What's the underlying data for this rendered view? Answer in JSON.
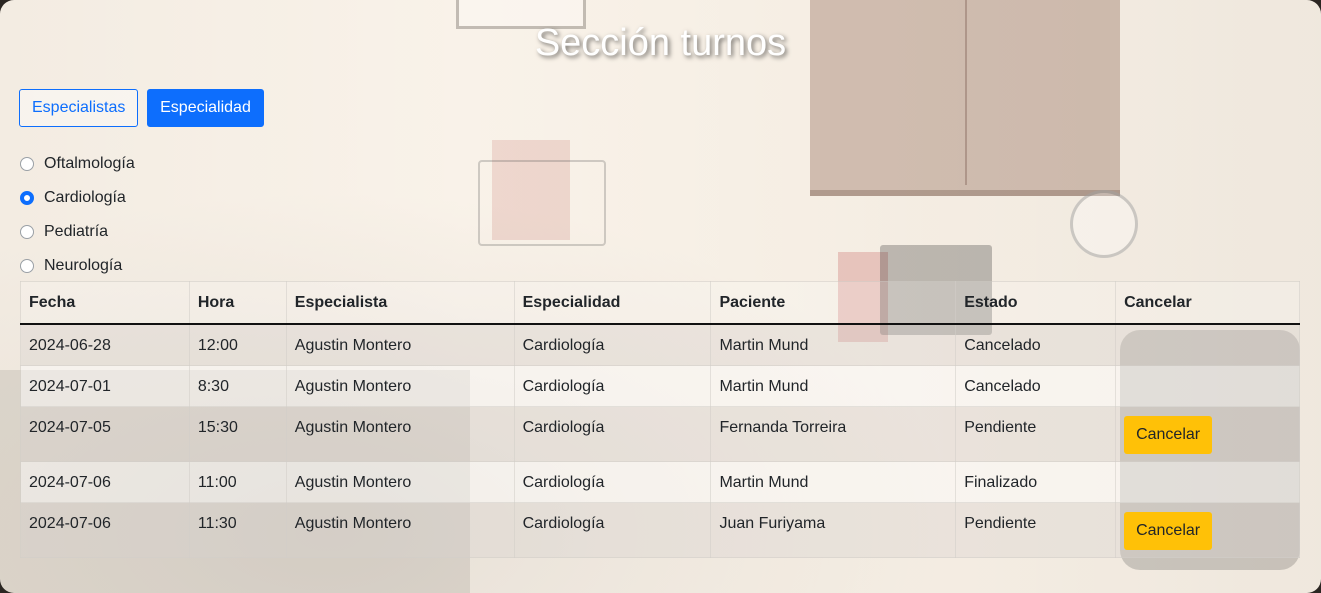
{
  "page": {
    "title": "Sección turnos"
  },
  "filter_buttons": {
    "especialistas_label": "Especialistas",
    "especialidad_label": "Especialidad"
  },
  "specialties": [
    {
      "label": "Oftalmología",
      "checked": false
    },
    {
      "label": "Cardiología",
      "checked": true
    },
    {
      "label": "Pediatría",
      "checked": false
    },
    {
      "label": "Neurología",
      "checked": false
    }
  ],
  "table": {
    "headers": [
      "Fecha",
      "Hora",
      "Especialista",
      "Especialidad",
      "Paciente",
      "Estado",
      "Cancelar"
    ],
    "rows": [
      {
        "fecha": "2024-06-28",
        "hora": "12:00",
        "especialista": "Agustin Montero",
        "especialidad": "Cardiología",
        "paciente": "Martin Mund",
        "estado": "Cancelado",
        "cancelar": ""
      },
      {
        "fecha": "2024-07-01",
        "hora": "8:30",
        "especialista": "Agustin Montero",
        "especialidad": "Cardiología",
        "paciente": "Martin Mund",
        "estado": "Cancelado",
        "cancelar": ""
      },
      {
        "fecha": "2024-07-05",
        "hora": "15:30",
        "especialista": "Agustin Montero",
        "especialidad": "Cardiología",
        "paciente": "Fernanda Torreira",
        "estado": "Pendiente",
        "cancelar": "Cancelar"
      },
      {
        "fecha": "2024-07-06",
        "hora": "11:00",
        "especialista": "Agustin Montero",
        "especialidad": "Cardiología",
        "paciente": "Martin Mund",
        "estado": "Finalizado",
        "cancelar": ""
      },
      {
        "fecha": "2024-07-06",
        "hora": "11:30",
        "especialista": "Agustin Montero",
        "especialidad": "Cardiología",
        "paciente": "Juan Furiyama",
        "estado": "Pendiente",
        "cancelar": "Cancelar"
      }
    ]
  },
  "colors": {
    "primary": "#0d6efd",
    "warning": "#ffc107"
  }
}
